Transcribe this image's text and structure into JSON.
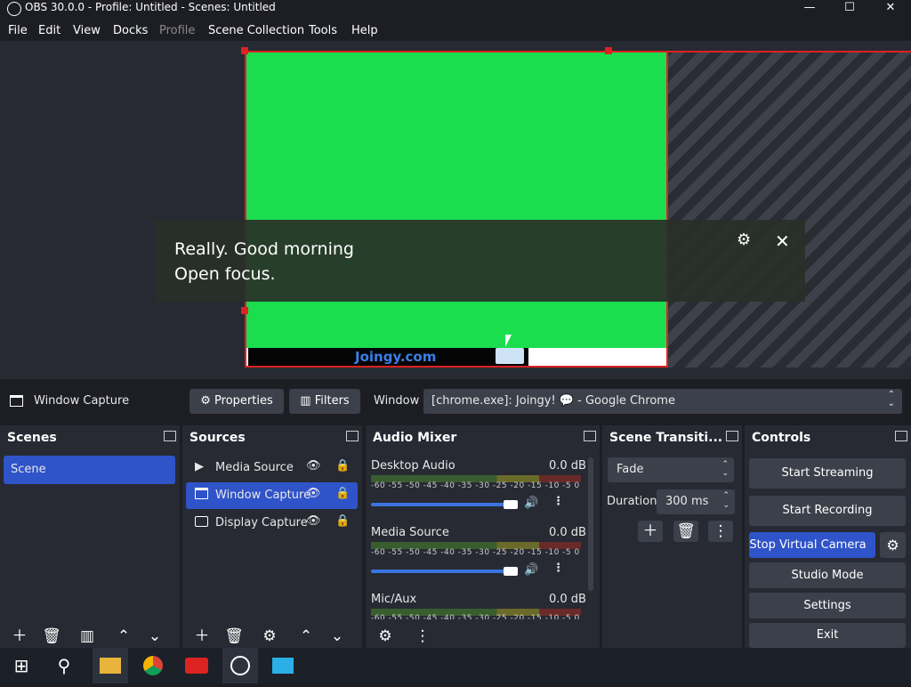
{
  "window": {
    "title": "OBS 30.0.0 - Profile: Untitled - Scenes: Untitled",
    "minimize": "—",
    "maximize": "☐",
    "close": "✕"
  },
  "menu": [
    "File",
    "Edit",
    "View",
    "Docks",
    "Profile",
    "Scene Collection",
    "Tools",
    "Help"
  ],
  "preview": {
    "site_text": "Joingy.com"
  },
  "caption": {
    "line1": "Really. Good morning",
    "line2": "Open focus."
  },
  "source_toolbar": {
    "source_name": "Window Capture",
    "properties": "Properties",
    "filters": "Filters",
    "window_label": "Window",
    "window_value": "[chrome.exe]: Joingy! 💬 - Google Chrome"
  },
  "scenes": {
    "title": "Scenes",
    "items": [
      "Scene"
    ]
  },
  "sources": {
    "title": "Sources",
    "items": [
      "Media Source",
      "Window Capture",
      "Display Capture"
    ]
  },
  "audio": {
    "title": "Audio Mixer",
    "ticks": "-60 -55 -50 -45 -40 -35 -30 -25 -20 -15 -10 -5 0",
    "channels": [
      {
        "name": "Desktop Audio",
        "db": "0.0 dB"
      },
      {
        "name": "Media Source",
        "db": "0.0 dB"
      },
      {
        "name": "Mic/Aux",
        "db": "0.0 dB"
      }
    ]
  },
  "transitions": {
    "title": "Scene Transiti...",
    "selected": "Fade",
    "duration_label": "Duration",
    "duration_value": "300 ms"
  },
  "controls": {
    "title": "Controls",
    "buttons": [
      "Start Streaming",
      "Start Recording",
      "Stop Virtual Camera",
      "Studio Mode",
      "Settings",
      "Exit"
    ]
  },
  "colors": {
    "accent": "#2f53c9",
    "green_screen": "#1bde4f",
    "bounding_box": "#dd2222"
  }
}
